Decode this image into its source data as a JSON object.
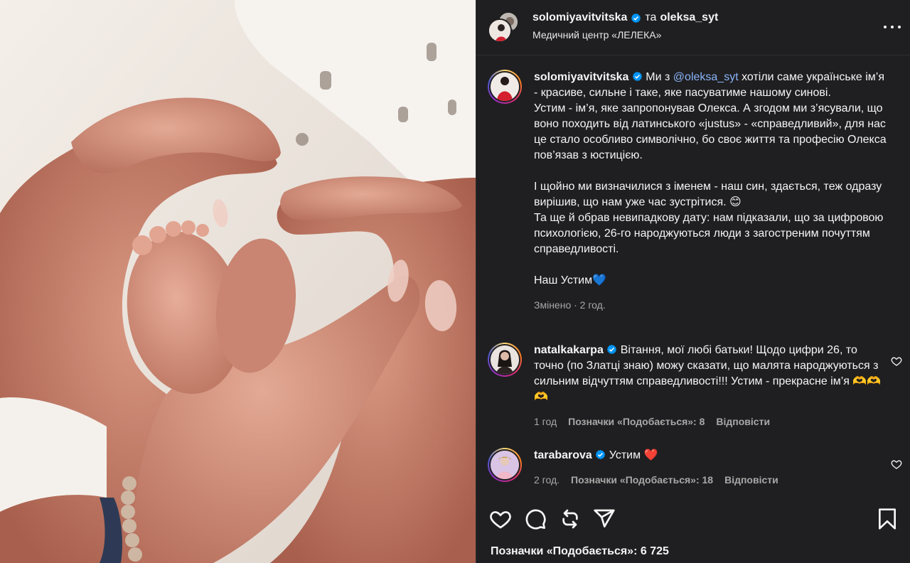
{
  "header": {
    "user1": "solomiyavitvitska",
    "conj": "та",
    "user2": "oleksa_syt",
    "location": "Медичний центр «ЛЕЛЕКА»"
  },
  "caption": {
    "username": "solomiyavitvitska",
    "text_before_mention": " Ми з ",
    "mention": "@oleksa_syt",
    "text_after_mention": " хотіли саме українське ім’я - красиве, сильне і таке, яке пасуватиме нашому синові.",
    "p2": "Устим - ім’я, яке запропонував Олекса. А згодом ми з’ясували, що воно походить від латинського «justus» - «справедливий», для нас це стало особливо символічно, бо своє життя та професію Олекса пов’язав з юстицією.",
    "p3": "І щойно ми визначилися з іменем - наш син, здається, теж одразу вирішив, що нам уже час зустрітися. 😊",
    "p4": "Та ще й обрав невипадкову дату: нам підказали, що за цифровою психологією, 26-го народжуються люди з загостреним почуттям справедливості.",
    "p5": "Наш Устим💙",
    "meta": "Змінено · 2 год."
  },
  "comments": [
    {
      "username": "natalkakarpa",
      "text": " Вітання, мої любі батьки! Щодо цифри 26, то точно (по Златці знаю) можу сказати, що малята народжуються з сильним відчуттям справедливості!!! Устим - прекрасне ім’я 🫶🫶🫶",
      "time": "1 год",
      "likes": "Позначки «Подобається»: 8",
      "reply": "Відповісти"
    },
    {
      "username": "tarabarova",
      "text": " Устим ❤️",
      "time": "2 год.",
      "likes": "Позначки «Подобається»: 18",
      "reply": "Відповісти"
    }
  ],
  "footer": {
    "likes": "Позначки «Подобається»: 6 725"
  },
  "icons": [
    "heart-icon",
    "comment-icon",
    "repost-icon",
    "share-icon",
    "bookmark-icon",
    "more-options-icon",
    "verified-badge-icon"
  ],
  "colors": {
    "panel_bg": "#1f1f21",
    "text": "#f5f5f5",
    "muted": "#a8a8a8",
    "verified": "#0095f6",
    "mention": "#8ab4f8"
  }
}
